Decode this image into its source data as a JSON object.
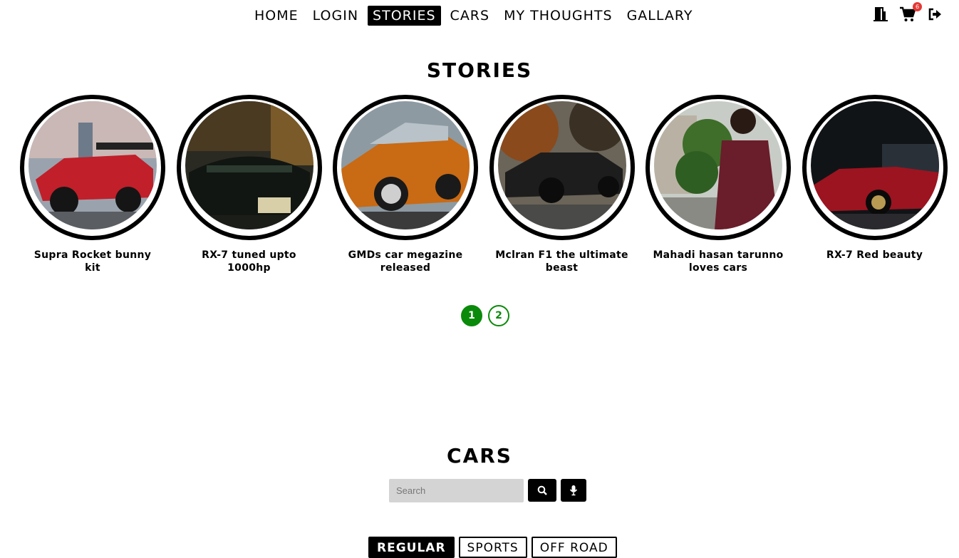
{
  "nav": {
    "links": [
      "HOME",
      "LOGIN",
      "STORIES",
      "CARS",
      "MY THOUGHTS",
      "GALLARY"
    ],
    "active": "STORIES",
    "cart_count": "6",
    "icons": [
      "door-exit-icon",
      "cart-icon",
      "logout-arrow-icon"
    ]
  },
  "stories_section": {
    "title": "STORIES",
    "items": [
      {
        "label": "Supra Rocket bunny kit",
        "color": "#b8222a"
      },
      {
        "label": "RX-7 tuned upto 1000hp",
        "color": "#1f231c"
      },
      {
        "label": "GMDs car megazine released",
        "color": "#c46a16"
      },
      {
        "label": "Mclran F1 the ultimate beast",
        "color": "#222222"
      },
      {
        "label": "Mahadi hasan tarunno loves cars",
        "color": "#6a1d2a"
      },
      {
        "label": "RX-7 Red beauty",
        "color": "#9c1420"
      }
    ]
  },
  "pagination": {
    "pages": [
      "1",
      "2"
    ],
    "current": "1",
    "color": "#0a8a0a"
  },
  "cars_section": {
    "title": "CARS",
    "search_placeholder": "Search",
    "search_icon": "search-icon",
    "mic_icon": "microphone-icon",
    "tabs": [
      "REGULAR",
      "SPORTS",
      "OFF ROAD"
    ],
    "active_tab": "REGULAR"
  }
}
